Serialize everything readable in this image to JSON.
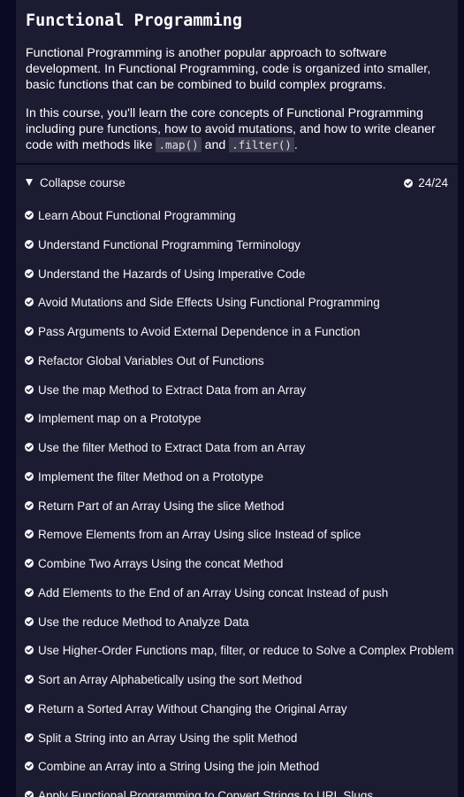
{
  "course": {
    "title": "Functional Programming",
    "description_1": "Functional Programming is another popular approach to software development. In Functional Programming, code is organized into smaller, basic functions that can be combined to build complex programs.",
    "description_2_before": "In this course, you'll learn the core concepts of Functional Programming including pure functions, how to avoid mutations, and how to write cleaner code with methods like ",
    "code_map": ".map()",
    "description_2_and": " and ",
    "code_filter": ".filter()",
    "description_2_after": "."
  },
  "toggle": {
    "label": "Collapse course",
    "progress": "24/24"
  },
  "challenges": [
    "Learn About Functional Programming",
    "Understand Functional Programming Terminology",
    "Understand the Hazards of Using Imperative Code",
    "Avoid Mutations and Side Effects Using Functional Programming",
    "Pass Arguments to Avoid External Dependence in a Function",
    "Refactor Global Variables Out of Functions",
    "Use the map Method to Extract Data from an Array",
    "Implement map on a Prototype",
    "Use the filter Method to Extract Data from an Array",
    "Implement the filter Method on a Prototype",
    "Return Part of an Array Using the slice Method",
    "Remove Elements from an Array Using slice Instead of splice",
    "Combine Two Arrays Using the concat Method",
    "Add Elements to the End of an Array Using concat Instead of push",
    "Use the reduce Method to Analyze Data",
    "Use Higher-Order Functions map, filter, or reduce to Solve a Complex Problem",
    "Sort an Array Alphabetically using the sort Method",
    "Return a Sorted Array Without Changing the Original Array",
    "Split a String into an Array Using the split Method",
    "Combine an Array into a String Using the join Method",
    "Apply Functional Programming to Convert Strings to URL Slugs"
  ],
  "colors": {
    "page_background": "#0a0a23",
    "panel_background": "#1b1b32",
    "text": "#f5f6f7",
    "code_background": "#3b3b4f"
  },
  "icons": {
    "completed": "check-circle-icon",
    "toggle": "caret-down-icon"
  }
}
